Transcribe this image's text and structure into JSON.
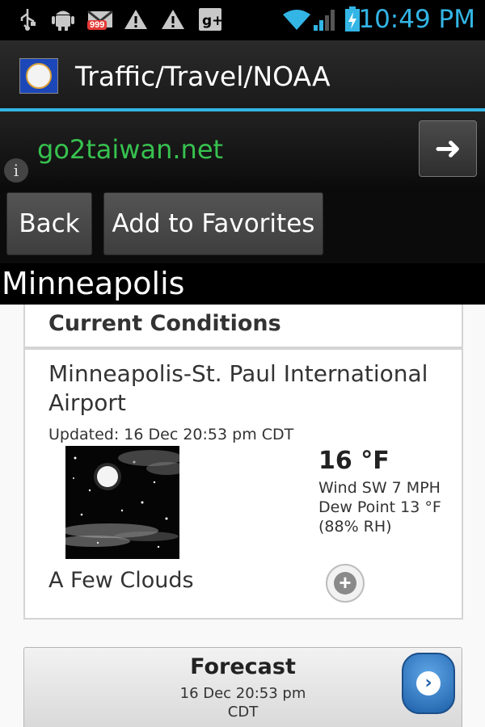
{
  "status_bar": {
    "time": "10:49 PM",
    "mail_badge": "999",
    "icons": [
      "usb-icon",
      "android-debug-icon",
      "gmail-icon",
      "warning-icon",
      "warning-icon",
      "google-plus-icon",
      "wifi-icon",
      "signal-icon",
      "battery-charging-icon"
    ]
  },
  "action_bar": {
    "title": "Traffic/Travel/NOAA",
    "app_icon": "minnesota-flag-icon"
  },
  "ad": {
    "text": "go2taiwan.net",
    "info_icon": "i",
    "arrow_icon": "➜"
  },
  "buttons": {
    "back": "Back",
    "add_favorites": "Add to Favorites"
  },
  "location": {
    "city": "Minneapolis"
  },
  "current": {
    "section_title": "Current Conditions",
    "station": "Minneapolis-St. Paul International Airport",
    "updated": "Updated: 16 Dec 20:53 pm CDT",
    "temperature": "16 °F",
    "wind": "Wind SW 7 MPH",
    "dew_point": "Dew Point 13 °F",
    "humidity": "(88% RH)",
    "condition": "A Few Clouds",
    "condition_icon": "night-few-clouds-icon",
    "plus_icon": "+"
  },
  "forecast": {
    "title": "Forecast",
    "date": "16 Dec 20:53 pm",
    "zone": "CDT",
    "arrow_icon": "›"
  },
  "colors": {
    "accent": "#33b5e5",
    "ad_text": "#37c24f",
    "forecast_button": "#1d5fa8"
  }
}
